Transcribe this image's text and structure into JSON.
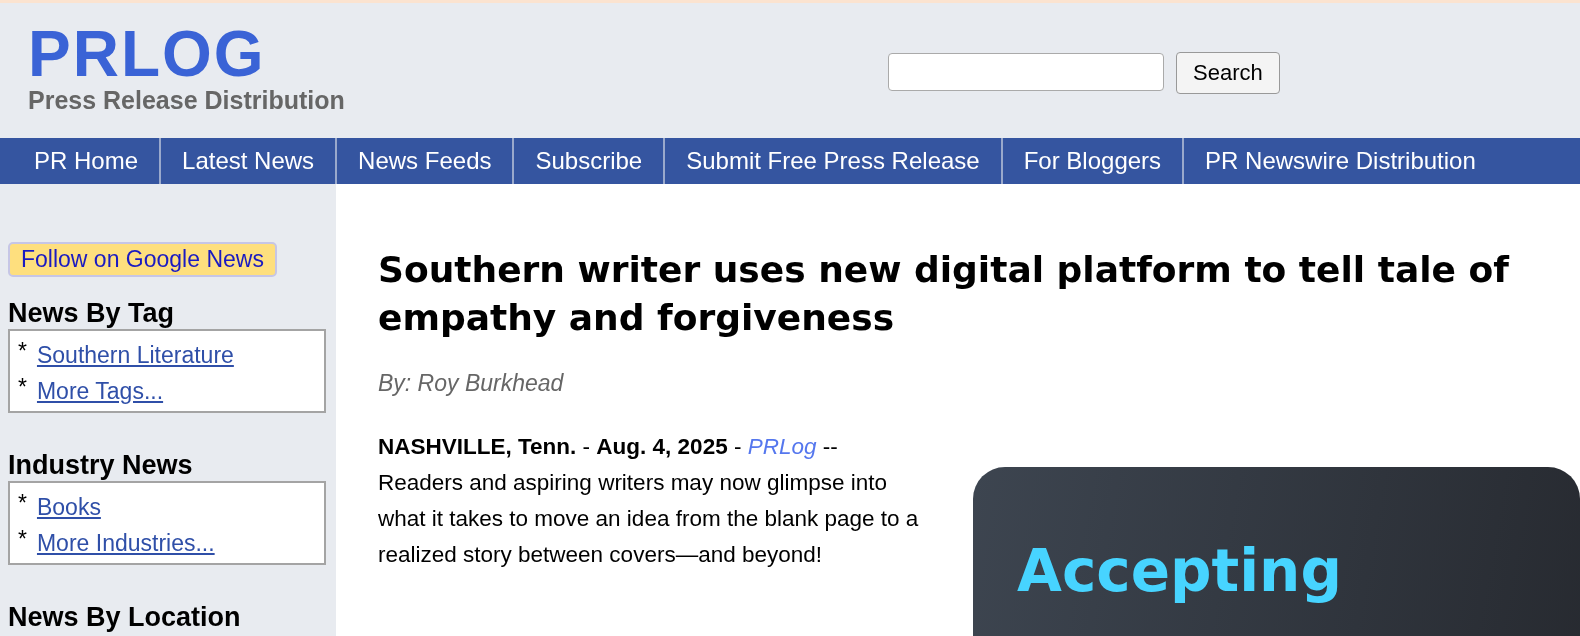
{
  "logo": {
    "title": "PRLOG",
    "tagline": "Press Release Distribution"
  },
  "search": {
    "button": "Search"
  },
  "nav": [
    {
      "label": "PR Home"
    },
    {
      "label": "Latest News"
    },
    {
      "label": "News Feeds"
    },
    {
      "label": "Subscribe"
    },
    {
      "label": "Submit Free Press Release"
    },
    {
      "label": "For Bloggers"
    },
    {
      "label": "PR Newswire Distribution"
    }
  ],
  "sidebar": {
    "follow_button": "Follow on Google News",
    "sections": [
      {
        "title": "News By Tag",
        "links": [
          {
            "bullet": "*",
            "label": "Southern Literature"
          },
          {
            "bullet": "*",
            "label": "More Tags..."
          }
        ]
      },
      {
        "title": "Industry News",
        "links": [
          {
            "bullet": "*",
            "label": "Books"
          },
          {
            "bullet": "*",
            "label": "More Industries..."
          }
        ]
      },
      {
        "title": "News By Location"
      }
    ]
  },
  "article": {
    "headline": "Southern writer uses new digital platform to tell tale of empathy and forgiveness",
    "byline": "By: Roy Burkhead",
    "body": "**NASHVILLE, Tenn.** - **Aug. 4, 2025** - *PRLog* -- Readers and aspiring writers may now glimpse into what it takes to move an idea from the blank page to a realized story between covers—and beyond!"
  },
  "promo": {
    "title": "Accepting"
  }
}
